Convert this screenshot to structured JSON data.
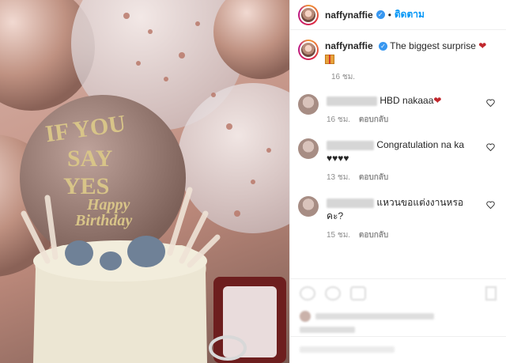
{
  "post": {
    "username": "naffynaffie",
    "follow_label": "ติดตาม",
    "caption": "The biggest surprise",
    "caption_time": "16 ชม."
  },
  "comments": [
    {
      "text": "HBD nakaaa",
      "time": "16 ชม.",
      "reply": "ตอบกลับ"
    },
    {
      "text": "Congratulation na ka",
      "text2": "♥♥♥♥",
      "time": "13 ชม.",
      "reply": "ตอบกลับ"
    },
    {
      "text": "แหวนขอแต่งงานหรอ",
      "text2": "คะ?",
      "time": "15 ชม.",
      "reply": "ตอบกลับ"
    }
  ],
  "cake_topper": {
    "line1": "IF YOU",
    "line2": "SAY",
    "line3": "YES",
    "line4": "Happy",
    "line5": "Birthday"
  },
  "colors": {
    "accent": "#0095f6",
    "verified": "#3897f0",
    "meta": "#8e8e8e",
    "heart_red": "#c1272d",
    "balloon_rose": "#c99b8e",
    "ring_box": "#6d1e1e"
  },
  "icons": [
    "verified-badge-icon",
    "heart-icon",
    "gift-icon",
    "like-heart-icon",
    "comment-icon",
    "share-icon",
    "bookmark-icon"
  ]
}
